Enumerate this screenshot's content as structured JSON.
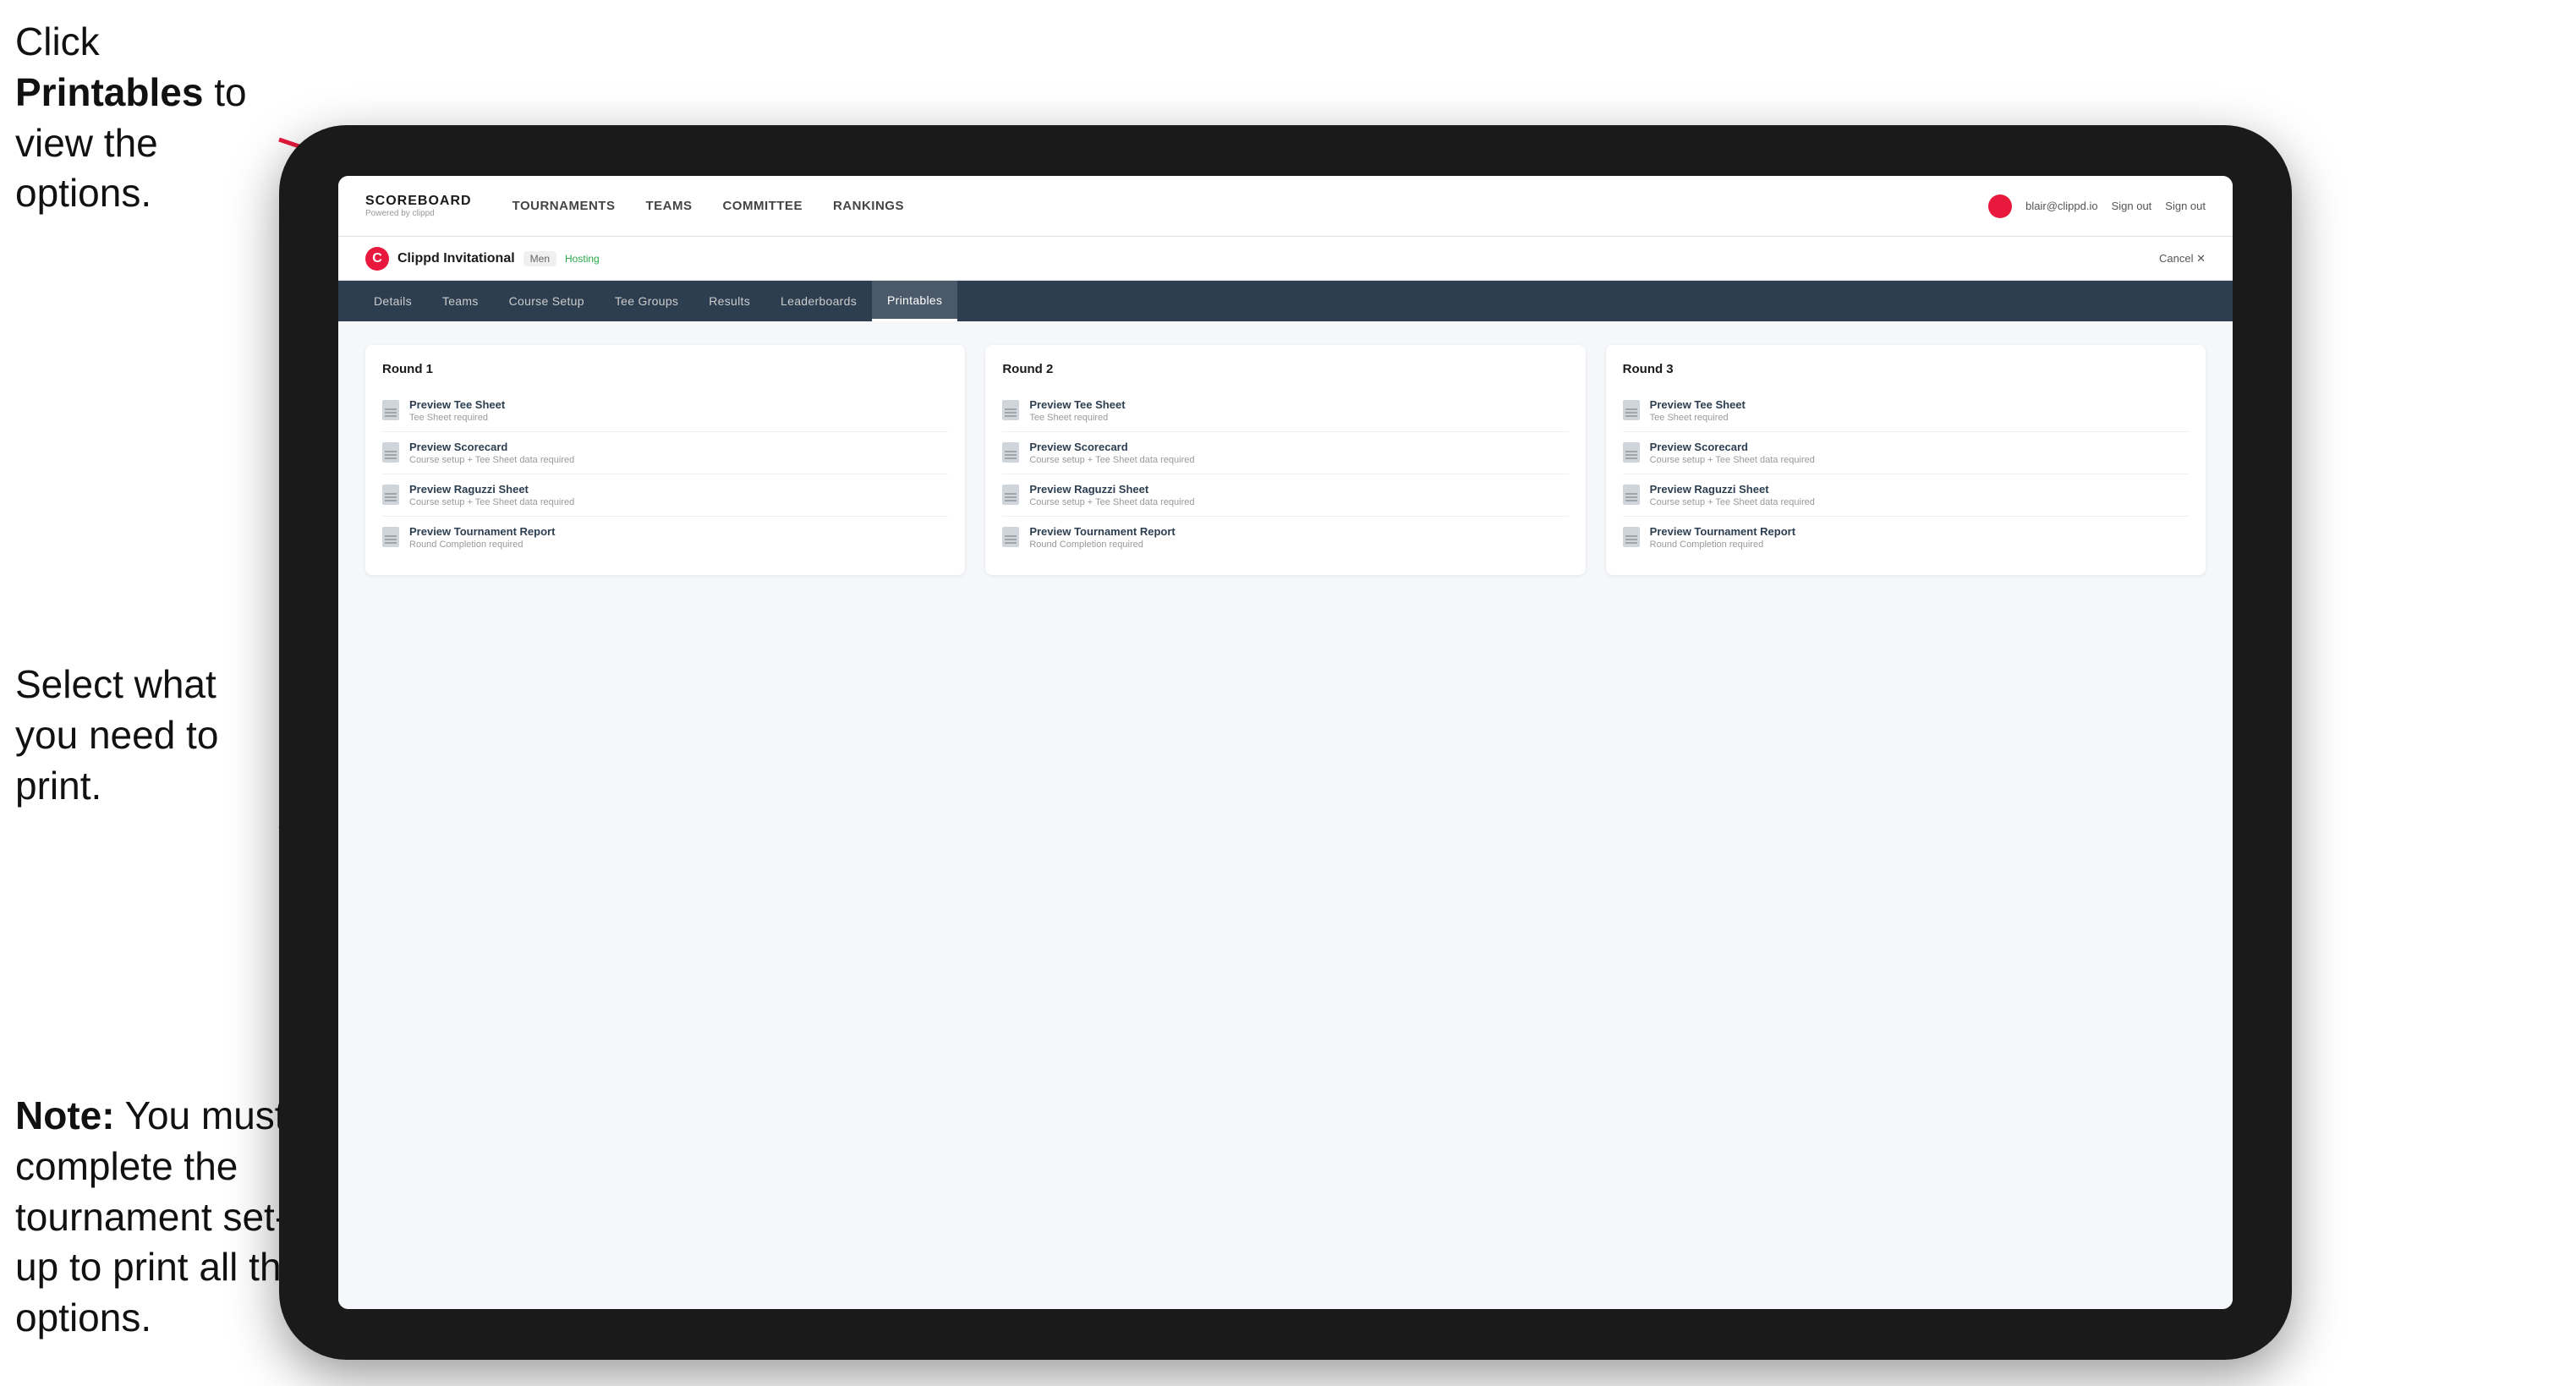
{
  "annotations": {
    "top": {
      "text_before": "Click ",
      "bold": "Printables",
      "text_after": " to view the options."
    },
    "middle": {
      "text": "Select what you need to print."
    },
    "bottom": {
      "bold_prefix": "Note:",
      "text": " You must complete the tournament set-up to print all the options."
    }
  },
  "nav": {
    "logo_title": "SCOREBOARD",
    "logo_subtitle": "Powered by clippd",
    "items": [
      {
        "label": "TOURNAMENTS",
        "active": false
      },
      {
        "label": "TEAMS",
        "active": false
      },
      {
        "label": "COMMITTEE",
        "active": false
      },
      {
        "label": "RANKINGS",
        "active": false
      }
    ],
    "user_email": "blair@clippd.io",
    "sign_out": "Sign out"
  },
  "tournament": {
    "name": "Clippd Invitational",
    "badge": "Men",
    "status": "Hosting",
    "cancel": "Cancel"
  },
  "tabs": [
    {
      "label": "Details",
      "active": false
    },
    {
      "label": "Teams",
      "active": false
    },
    {
      "label": "Course Setup",
      "active": false
    },
    {
      "label": "Tee Groups",
      "active": false
    },
    {
      "label": "Results",
      "active": false
    },
    {
      "label": "Leaderboards",
      "active": false
    },
    {
      "label": "Printables",
      "active": true
    }
  ],
  "rounds": [
    {
      "title": "Round 1",
      "items": [
        {
          "title": "Preview Tee Sheet",
          "subtitle": "Tee Sheet required"
        },
        {
          "title": "Preview Scorecard",
          "subtitle": "Course setup + Tee Sheet data required"
        },
        {
          "title": "Preview Raguzzi Sheet",
          "subtitle": "Course setup + Tee Sheet data required"
        },
        {
          "title": "Preview Tournament Report",
          "subtitle": "Round Completion required"
        }
      ]
    },
    {
      "title": "Round 2",
      "items": [
        {
          "title": "Preview Tee Sheet",
          "subtitle": "Tee Sheet required"
        },
        {
          "title": "Preview Scorecard",
          "subtitle": "Course setup + Tee Sheet data required"
        },
        {
          "title": "Preview Raguzzi Sheet",
          "subtitle": "Course setup + Tee Sheet data required"
        },
        {
          "title": "Preview Tournament Report",
          "subtitle": "Round Completion required"
        }
      ]
    },
    {
      "title": "Round 3",
      "items": [
        {
          "title": "Preview Tee Sheet",
          "subtitle": "Tee Sheet required"
        },
        {
          "title": "Preview Scorecard",
          "subtitle": "Course setup + Tee Sheet data required"
        },
        {
          "title": "Preview Raguzzi Sheet",
          "subtitle": "Course setup + Tee Sheet data required"
        },
        {
          "title": "Preview Tournament Report",
          "subtitle": "Round Completion required"
        }
      ]
    }
  ]
}
